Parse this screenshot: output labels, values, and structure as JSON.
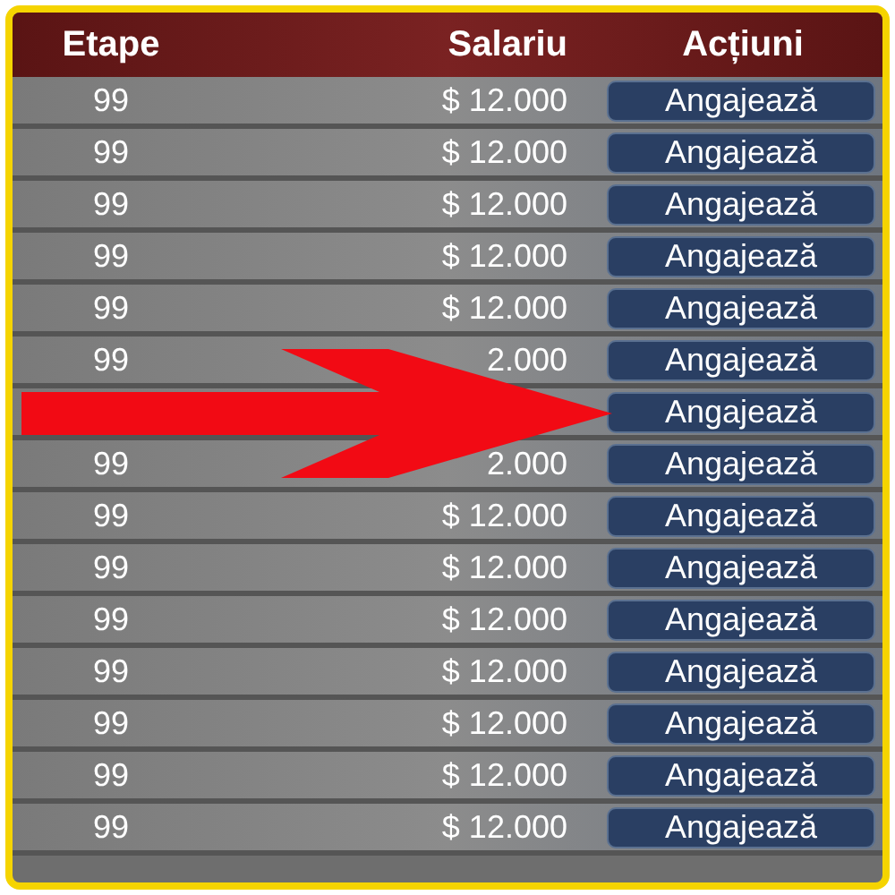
{
  "table": {
    "columns": [
      "Etape",
      "Salariu",
      "Acțiuni"
    ],
    "rows": [
      {
        "etape": "99",
        "salary": "$ 12.000",
        "action": "Angajează"
      },
      {
        "etape": "99",
        "salary": "$ 12.000",
        "action": "Angajează"
      },
      {
        "etape": "99",
        "salary": "$ 12.000",
        "action": "Angajează"
      },
      {
        "etape": "99",
        "salary": "$ 12.000",
        "action": "Angajează"
      },
      {
        "etape": "99",
        "salary": "$ 12.000",
        "action": "Angajează"
      },
      {
        "etape": "99",
        "salary": "2.000",
        "action": "Angajează"
      },
      {
        "action": "Angajează"
      },
      {
        "etape": "99",
        "salary": "2.000",
        "action": "Angajează"
      },
      {
        "etape": "99",
        "salary": "$ 12.000",
        "action": "Angajează"
      },
      {
        "etape": "99",
        "salary": "$ 12.000",
        "action": "Angajează"
      },
      {
        "etape": "99",
        "salary": "$ 12.000",
        "action": "Angajează"
      },
      {
        "etape": "99",
        "salary": "$ 12.000",
        "action": "Angajează"
      },
      {
        "etape": "99",
        "salary": "$ 12.000",
        "action": "Angajează"
      },
      {
        "etape": "99",
        "salary": "$ 12.000",
        "action": "Angajează"
      },
      {
        "etape": "99",
        "salary": "$ 12.000",
        "action": "Angajează"
      }
    ]
  }
}
